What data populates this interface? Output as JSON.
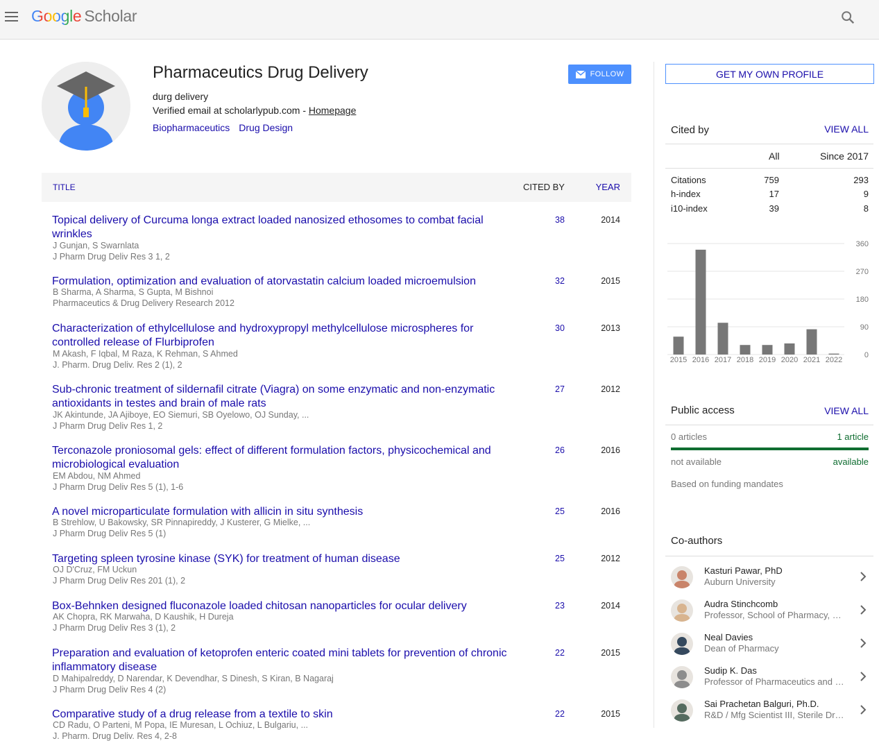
{
  "header": {
    "logo_google": "Google",
    "logo_scholar": "Scholar"
  },
  "profile": {
    "name": "Pharmaceutics Drug Delivery",
    "affiliation": "durg delivery",
    "email_text": "Verified email at scholarlypub.com - ",
    "homepage_label": "Homepage",
    "interests": [
      "Biopharmaceutics",
      "Drug Design"
    ],
    "follow_label": "FOLLOW"
  },
  "table": {
    "col_title": "TITLE",
    "col_cited": "CITED BY",
    "col_year": "YEAR",
    "rows": [
      {
        "title": "Topical delivery of Curcuma longa extract loaded nanosized ethosomes to combat facial wrinkles",
        "authors": "J Gunjan, S Swarnlata",
        "venue": "J Pharm Drug Deliv Res 3 1, 2",
        "cited": "38",
        "year": "2014"
      },
      {
        "title": "Formulation, optimization and evaluation of atorvastatin calcium loaded microemulsion",
        "authors": "B Sharma, A Sharma, S Gupta, M Bishnoi",
        "venue": "Pharmaceutics & Drug Delivery Research 2012",
        "cited": "32",
        "year": "2015"
      },
      {
        "title": "Characterization of ethylcellulose and hydroxypropyl methylcellulose microspheres for controlled release of Flurbiprofen",
        "authors": "M Akash, F Iqbal, M Raza, K Rehman, S Ahmed",
        "venue": "J. Pharm. Drug Deliv. Res 2 (1), 2",
        "cited": "30",
        "year": "2013"
      },
      {
        "title": "Sub-chronic treatment of sildernafil citrate (Viagra) on some enzymatic and non-enzymatic antioxidants in testes and brain of male rats",
        "authors": "JK Akintunde, JA Ajiboye, EO Siemuri, SB Oyelowo, OJ Sunday, ...",
        "venue": "J Pharm Drug Deliv Res 1, 2",
        "cited": "27",
        "year": "2012"
      },
      {
        "title": "Terconazole proniosomal gels: effect of different formulation factors, physicochemical and microbiological evaluation",
        "authors": "EM Abdou, NM Ahmed",
        "venue": "J Pharm Drug Deliv Res 5 (1), 1-6",
        "cited": "26",
        "year": "2016"
      },
      {
        "title": "A novel microparticulate formulation with allicin in situ synthesis",
        "authors": "B Strehlow, U Bakowsky, SR Pinnapireddy, J Kusterer, G Mielke, ...",
        "venue": "J Pharm Drug Deliv Res 5 (1)",
        "cited": "25",
        "year": "2016"
      },
      {
        "title": "Targeting spleen tyrosine kinase (SYK) for treatment of human disease",
        "authors": "OJ D'Cruz, FM Uckun",
        "venue": "J Pharm Drug Deliv Res 201 (1), 2",
        "cited": "25",
        "year": "2012"
      },
      {
        "title": "Box-Behnken designed fluconazole loaded chitosan nanoparticles for ocular delivery",
        "authors": "AK Chopra, RK Marwaha, D Kaushik, H Dureja",
        "venue": "J Pharm Drug Deliv Res 3 (1), 2",
        "cited": "23",
        "year": "2014"
      },
      {
        "title": "Preparation and evaluation of ketoprofen enteric coated mini tablets for prevention of chronic inflammatory disease",
        "authors": "D Mahipalreddy, D Narendar, K Devendhar, S Dinesh, S Kiran, B Nagaraj",
        "venue": "J Pharm Drug Deliv Res 4 (2)",
        "cited": "22",
        "year": "2015"
      },
      {
        "title": "Comparative study of a drug release from a textile to skin",
        "authors": "CD Radu, O Parteni, M Popa, IE Muresan, L Ochiuz, L Bulgariu, ...",
        "venue": "J. Pharm. Drug Deliv. Res 4, 2-8",
        "cited": "22",
        "year": "2015"
      }
    ]
  },
  "sidebar": {
    "get_profile_label": "GET MY OWN PROFILE",
    "cited_by": {
      "heading": "Cited by",
      "view_all": "VIEW ALL",
      "col_all": "All",
      "col_since": "Since 2017",
      "rows": [
        {
          "label": "Citations",
          "all": "759",
          "since": "293"
        },
        {
          "label": "h-index",
          "all": "17",
          "since": "9"
        },
        {
          "label": "i10-index",
          "all": "39",
          "since": "8"
        }
      ]
    },
    "public_access": {
      "heading": "Public access",
      "view_all": "VIEW ALL",
      "left_count": "0 articles",
      "right_count": "1 article",
      "left_status": "not available",
      "right_status": "available",
      "note": "Based on funding mandates"
    },
    "coauthors": {
      "heading": "Co-authors",
      "items": [
        {
          "name": "Kasturi Pawar, PhD",
          "affiliation": "Auburn University"
        },
        {
          "name": "Audra Stinchcomb",
          "affiliation": "Professor, School of Pharmacy, University of Maryland"
        },
        {
          "name": "Neal Davies",
          "affiliation": "Dean of Pharmacy"
        },
        {
          "name": "Sudip K. Das",
          "affiliation": "Professor of Pharmaceutics and Pharmaceutical Sciences"
        },
        {
          "name": "Sai Prachetan Balguri, Ph.D.",
          "affiliation": "R&D / Mfg Scientist III, Sterile Drug Products"
        }
      ]
    }
  },
  "colors": {
    "link": "#1a0dab",
    "follow_bg": "#4d90fe",
    "bar": "#777777",
    "access_green": "#0f6d31"
  },
  "chart_data": {
    "type": "bar",
    "categories": [
      "2015",
      "2016",
      "2017",
      "2018",
      "2019",
      "2020",
      "2021",
      "2022"
    ],
    "values": [
      58,
      340,
      103,
      31,
      31,
      36,
      82,
      3
    ],
    "yticks": [
      "360",
      "270",
      "180",
      "90",
      "0"
    ],
    "ylim": [
      0,
      360
    ],
    "grid": true
  }
}
